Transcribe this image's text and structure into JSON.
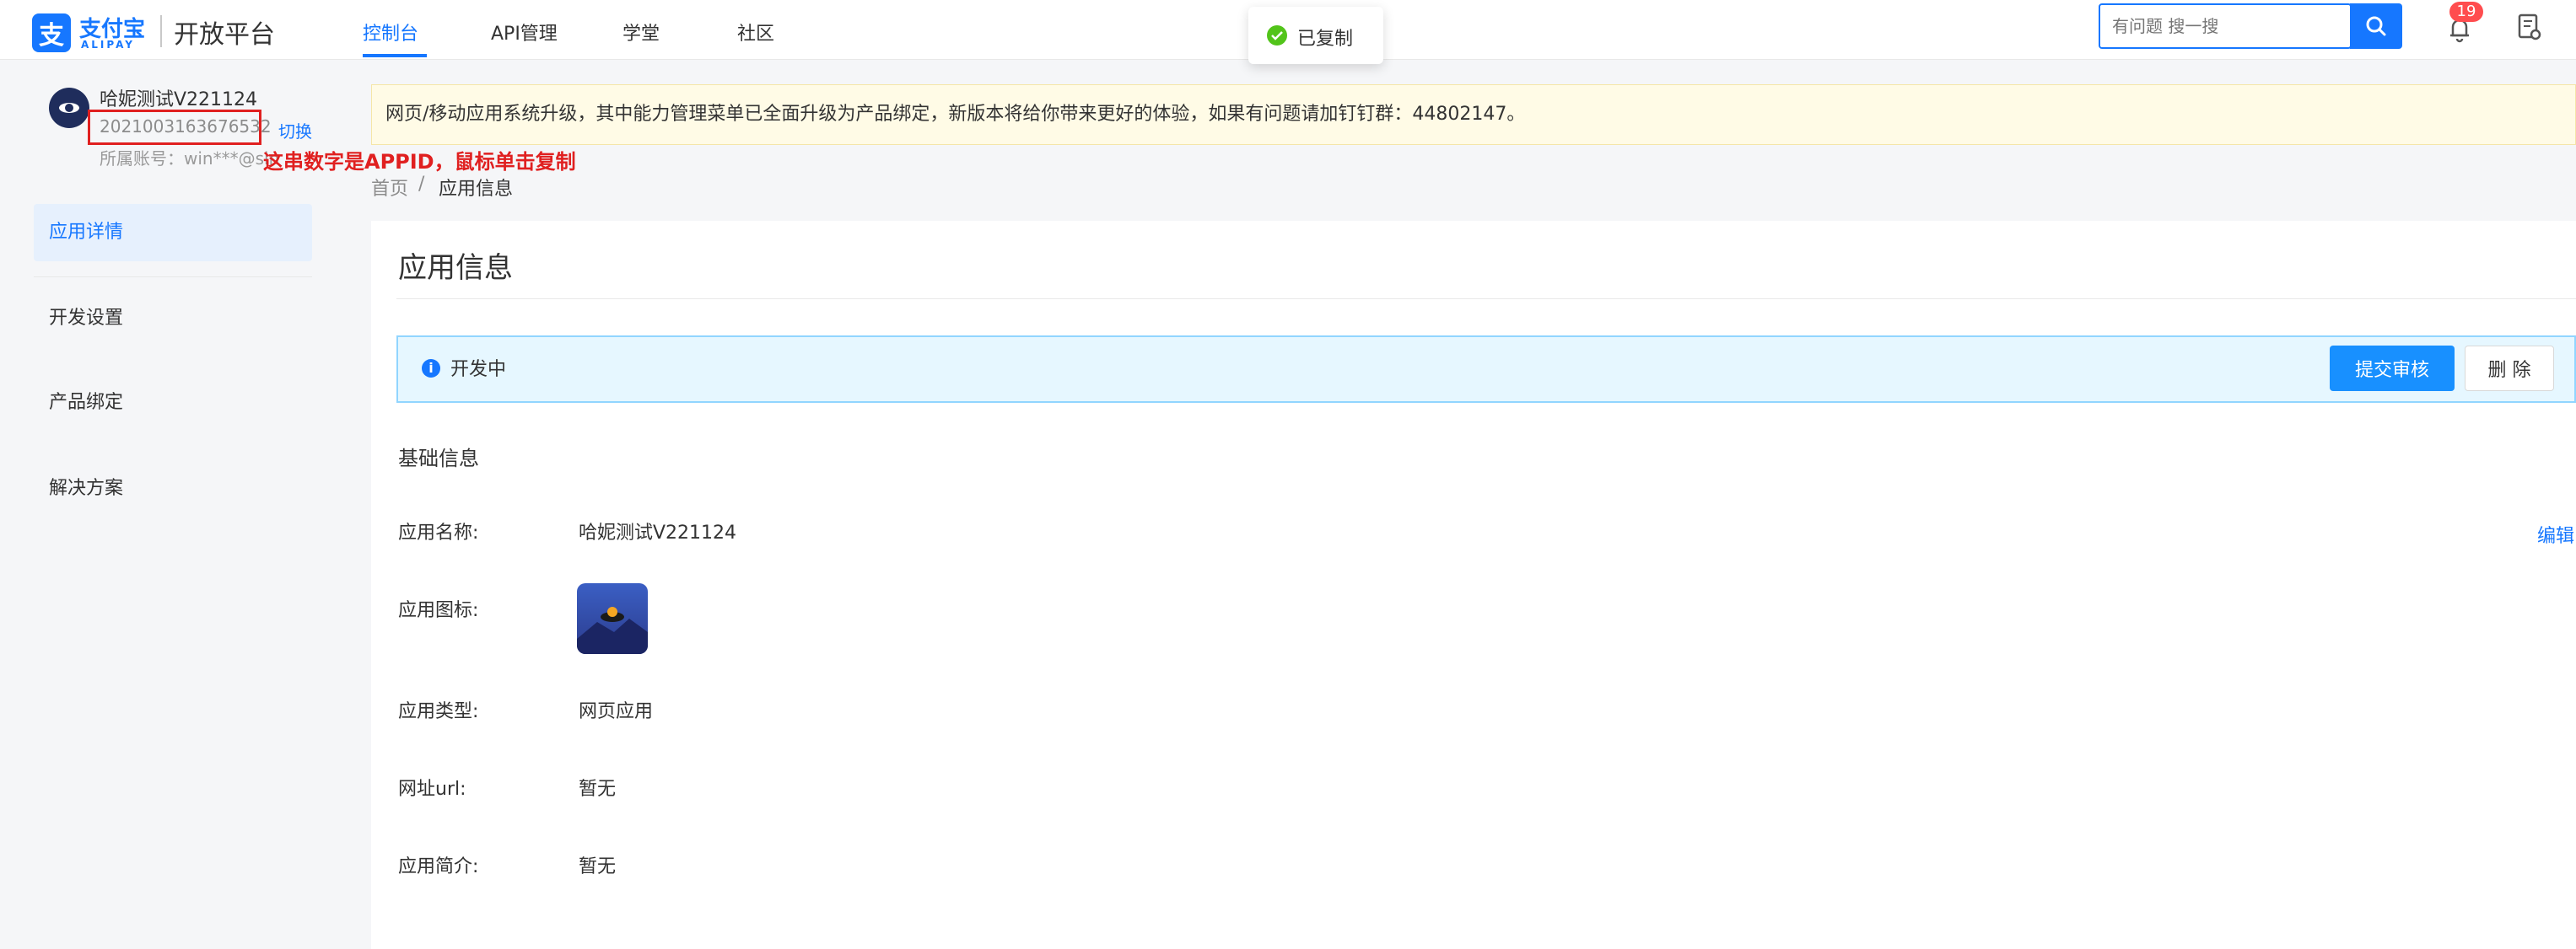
{
  "header": {
    "logo_cn": "支付宝",
    "logo_en": "ALIPAY",
    "platform": "开放平台",
    "nav": [
      "控制台",
      "API管理",
      "学堂",
      "社区"
    ],
    "active_nav_index": 0,
    "search_placeholder": "有问题 搜一搜",
    "notification_count": "19",
    "icons": {
      "search": "search-icon",
      "bell": "bell-icon",
      "doc": "document-settings-icon"
    }
  },
  "toast": {
    "text": "已复制",
    "color": "#52c41a"
  },
  "sidebar": {
    "app_name": "哈妮测试V221124",
    "appid": "2021003163676532",
    "switch": "切换",
    "account": "所属账号：win***@sin",
    "annotation": "这串数字是APPID，鼠标单击复制",
    "items": [
      "应用详情",
      "开发设置",
      "产品绑定",
      "解决方案"
    ],
    "active_index": 0
  },
  "notice": "网页/移动应用系统升级，其中能力管理菜单已全面升级为产品绑定，新版本将给你带来更好的体验，如果有问题请加钉钉群：44802147。",
  "breadcrumb": [
    "首页",
    "/",
    "应用信息"
  ],
  "main": {
    "title": "应用信息",
    "status": "开发中",
    "btn_submit": "提交审核",
    "btn_delete": "删 除",
    "section": "基础信息",
    "edit": "编辑",
    "fields": {
      "name": {
        "label": "应用名称:",
        "value": "哈妮测试V221124"
      },
      "icon": {
        "label": "应用图标:"
      },
      "type": {
        "label": "应用类型:",
        "value": "网页应用"
      },
      "url": {
        "label": "网址url:",
        "value": "暂无"
      },
      "intro": {
        "label": "应用简介:",
        "value": "暂无"
      }
    }
  },
  "colors": {
    "primary": "#1677ff",
    "annotation": "#e02020",
    "notice_bg": "#fffbe6",
    "status_bg": "#e6f7ff"
  }
}
